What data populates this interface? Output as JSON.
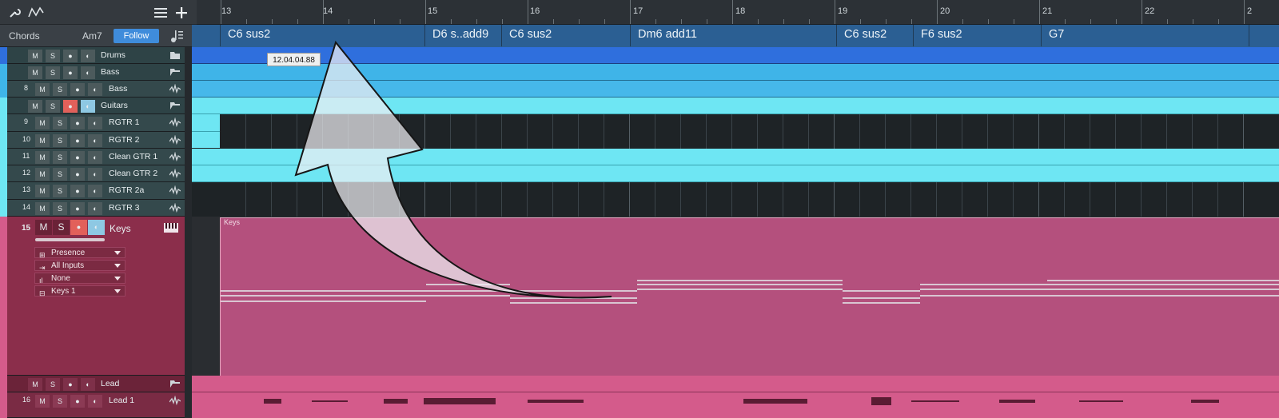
{
  "toolbar": {
    "wrench_icon": "wrench-icon",
    "automation_icon": "automation-icon",
    "list_icon": "list-icon",
    "add_icon": "add-icon"
  },
  "chord_track": {
    "label": "Chords",
    "key": "Am7",
    "follow_label": "Follow"
  },
  "ruler": {
    "bars": [
      "13",
      "14",
      "15",
      "16",
      "17",
      "18",
      "19",
      "20",
      "21",
      "22",
      "2"
    ]
  },
  "chords": [
    "C6 sus2",
    "D6 s..add9",
    "C6 sus2",
    "Dm6 add11",
    "C6 sus2",
    "F6 sus2",
    "G7"
  ],
  "tooltip": "12.04.04.88",
  "tracks": [
    {
      "num": "",
      "name": "Drums",
      "color": "#2f6fdd"
    },
    {
      "num": "",
      "name": "Bass",
      "color": "#3fb4e8"
    },
    {
      "num": "8",
      "name": "Bass",
      "color": "#3fb4e8"
    },
    {
      "num": "",
      "name": "Guitars",
      "color": "#6ee6f3"
    },
    {
      "num": "9",
      "name": "RGTR 1",
      "color": "#6ee6f3"
    },
    {
      "num": "10",
      "name": "RGTR 2",
      "color": "#6ee6f3"
    },
    {
      "num": "11",
      "name": "Clean GTR 1",
      "color": "#6ee6f3"
    },
    {
      "num": "12",
      "name": "Clean GTR 2",
      "color": "#6ee6f3"
    },
    {
      "num": "13",
      "name": "RGTR 2a",
      "color": "#6ee6f3"
    },
    {
      "num": "14",
      "name": "RGTR 3",
      "color": "#6ee6f3"
    },
    {
      "num": "15",
      "name": "Keys",
      "color": "#b84e7b"
    },
    {
      "num": "",
      "name": "Lead",
      "color": "#d45b8b"
    },
    {
      "num": "16",
      "name": "Lead 1",
      "color": "#d45b8b"
    }
  ],
  "keys_track": {
    "preset": "Presence",
    "input": "All Inputs",
    "output": "None",
    "instrument": "Keys 1",
    "event_label": "Keys"
  },
  "buttons": {
    "mute": "M",
    "solo": "S"
  },
  "colors": {
    "drums": "#2f6fdd",
    "bass": "#3fb4e8",
    "guitars": "#6ee6f3",
    "keys": "#b84e7b",
    "lead": "#d45b8b",
    "chord_lane": "#2b5f93",
    "follow": "#3f8cdb",
    "record": "#e2605a"
  }
}
